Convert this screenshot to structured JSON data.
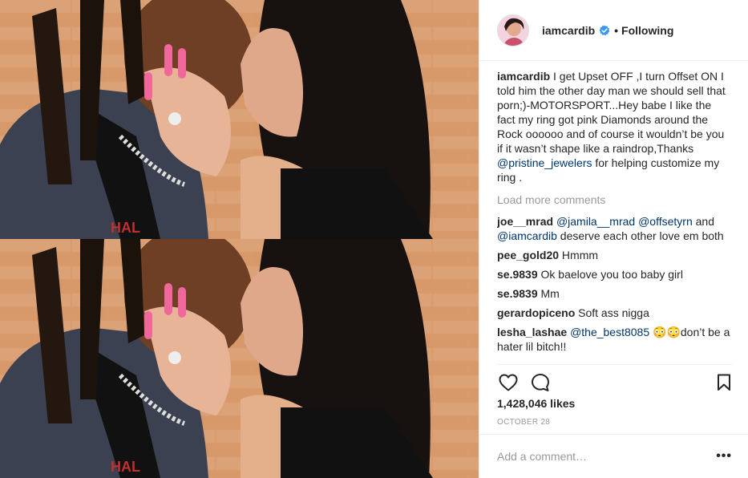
{
  "post": {
    "username": "iamcardib",
    "follow_status": "Following",
    "caption_text": " I get Upset OFF ,I turn Offset ON I told him the other day man we should sell that porn;)-MOTORSPORT...Hey babe I like the fact my ring got pink Diamonds around the Rock oooooo and of course it wouldn’t be you if it wasn’t shape like a raindrop,Thanks ",
    "caption_mention": "@pristine_jewelers",
    "caption_tail": " for helping customize my ring .",
    "load_more": "Load more comments",
    "likes": "1,428,046 likes",
    "date": "OCTOBER 28",
    "add_comment_placeholder": "Add a comment…",
    "more_label": "•••"
  },
  "comments": [
    {
      "user": "joe__mrad",
      "mentions": [
        "@jamila__mrad",
        "@offsetyrn",
        "@iamcardib"
      ],
      "text_mid": " and ",
      "text_end": " deserve each other love em both"
    },
    {
      "user": "pee_gold20",
      "text": " Hmmm"
    },
    {
      "user": "se.9839",
      "text": " Ok baelove you too baby girl"
    },
    {
      "user": "se.9839",
      "text": " Mm"
    },
    {
      "user": "gerardopiceno",
      "text": " Soft ass nigga"
    },
    {
      "user": "lesha_lashae",
      "mention": "@the_best8085",
      "text": " 😳😳don’t be a hater lil bitch!!"
    }
  ],
  "icons": {
    "verified": "verified-badge-icon",
    "like": "heart-icon",
    "comment": "comment-bubble-icon",
    "save": "bookmark-icon",
    "more": "more-options-icon"
  },
  "colors": {
    "verified": "#3897f0",
    "mention": "#003569",
    "muted": "#999999",
    "text": "#262626",
    "border": "#efefef"
  }
}
